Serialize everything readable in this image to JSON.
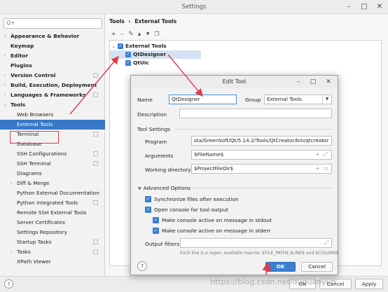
{
  "window": {
    "title": "Settings"
  },
  "search": {
    "placeholder": "Q+"
  },
  "sidebar": {
    "items": [
      {
        "label": "Appearance & Behavior"
      },
      {
        "label": "Keymap"
      },
      {
        "label": "Editor"
      },
      {
        "label": "Plugins"
      },
      {
        "label": "Version Control"
      },
      {
        "label": "Build, Execution, Deployment"
      },
      {
        "label": "Languages & Frameworks"
      },
      {
        "label": "Tools"
      },
      {
        "label": "Web Browsers"
      },
      {
        "label": "External Tools"
      },
      {
        "label": "Terminal"
      },
      {
        "label": "Database"
      },
      {
        "label": "SSH Configurations"
      },
      {
        "label": "SSH Terminal"
      },
      {
        "label": "Diagrams"
      },
      {
        "label": "Diff & Merge"
      },
      {
        "label": "Python External Documentation"
      },
      {
        "label": "Python Integrated Tools"
      },
      {
        "label": "Remote SSH External Tools"
      },
      {
        "label": "Server Certificates"
      },
      {
        "label": "Settings Repository"
      },
      {
        "label": "Startup Tasks"
      },
      {
        "label": "Tasks"
      },
      {
        "label": "XPath Viewer"
      }
    ]
  },
  "breadcrumb": {
    "root": "Tools",
    "separator": "›",
    "current": "External Tools"
  },
  "tree": {
    "group": "External Tools",
    "tools": [
      "QtDesigner",
      "QtUic"
    ]
  },
  "dialog": {
    "title": "Edit Tool",
    "name_label": "Name",
    "name_value": "QtDesigner",
    "group_label": "Group",
    "group_value": "External Tools",
    "description_label": "Description",
    "description_value": "",
    "tool_settings_label": "Tool Settings",
    "program_label": "Program",
    "program_value": "sta/GreenSoft/Qt/5.14.2/Tools/QtCreator/bin/qtcreator",
    "arguments_label": "Arguments",
    "arguments_value": "$FileName$",
    "workdir_label": "Working directory",
    "workdir_value": "$ProjectFileDir$",
    "advanced_label": "Advanced Options",
    "opt_sync": "Synchronize files after execution",
    "opt_console": "Open console for tool output",
    "opt_stdout": "Make console active on message in stdout",
    "opt_stderr": "Make console active on message in stderr",
    "output_filters_label": "Output filters",
    "hint": "Each line is a regex, available macros: $FILE_PATH$ $LINE$ and $COLUMN$",
    "ok_label": "OK",
    "cancel_label": "Cancel",
    "help_label": "?"
  },
  "footer": {
    "help_label": "?",
    "ok_label": "OK",
    "cancel_label": "Cancel",
    "apply_label": "Apply"
  },
  "watermark": "https://blog.csdn.net/duguanyun",
  "colors": {
    "accent": "#3b7fd1",
    "selection": "#3878c7",
    "annotation": "#e23a4c"
  }
}
